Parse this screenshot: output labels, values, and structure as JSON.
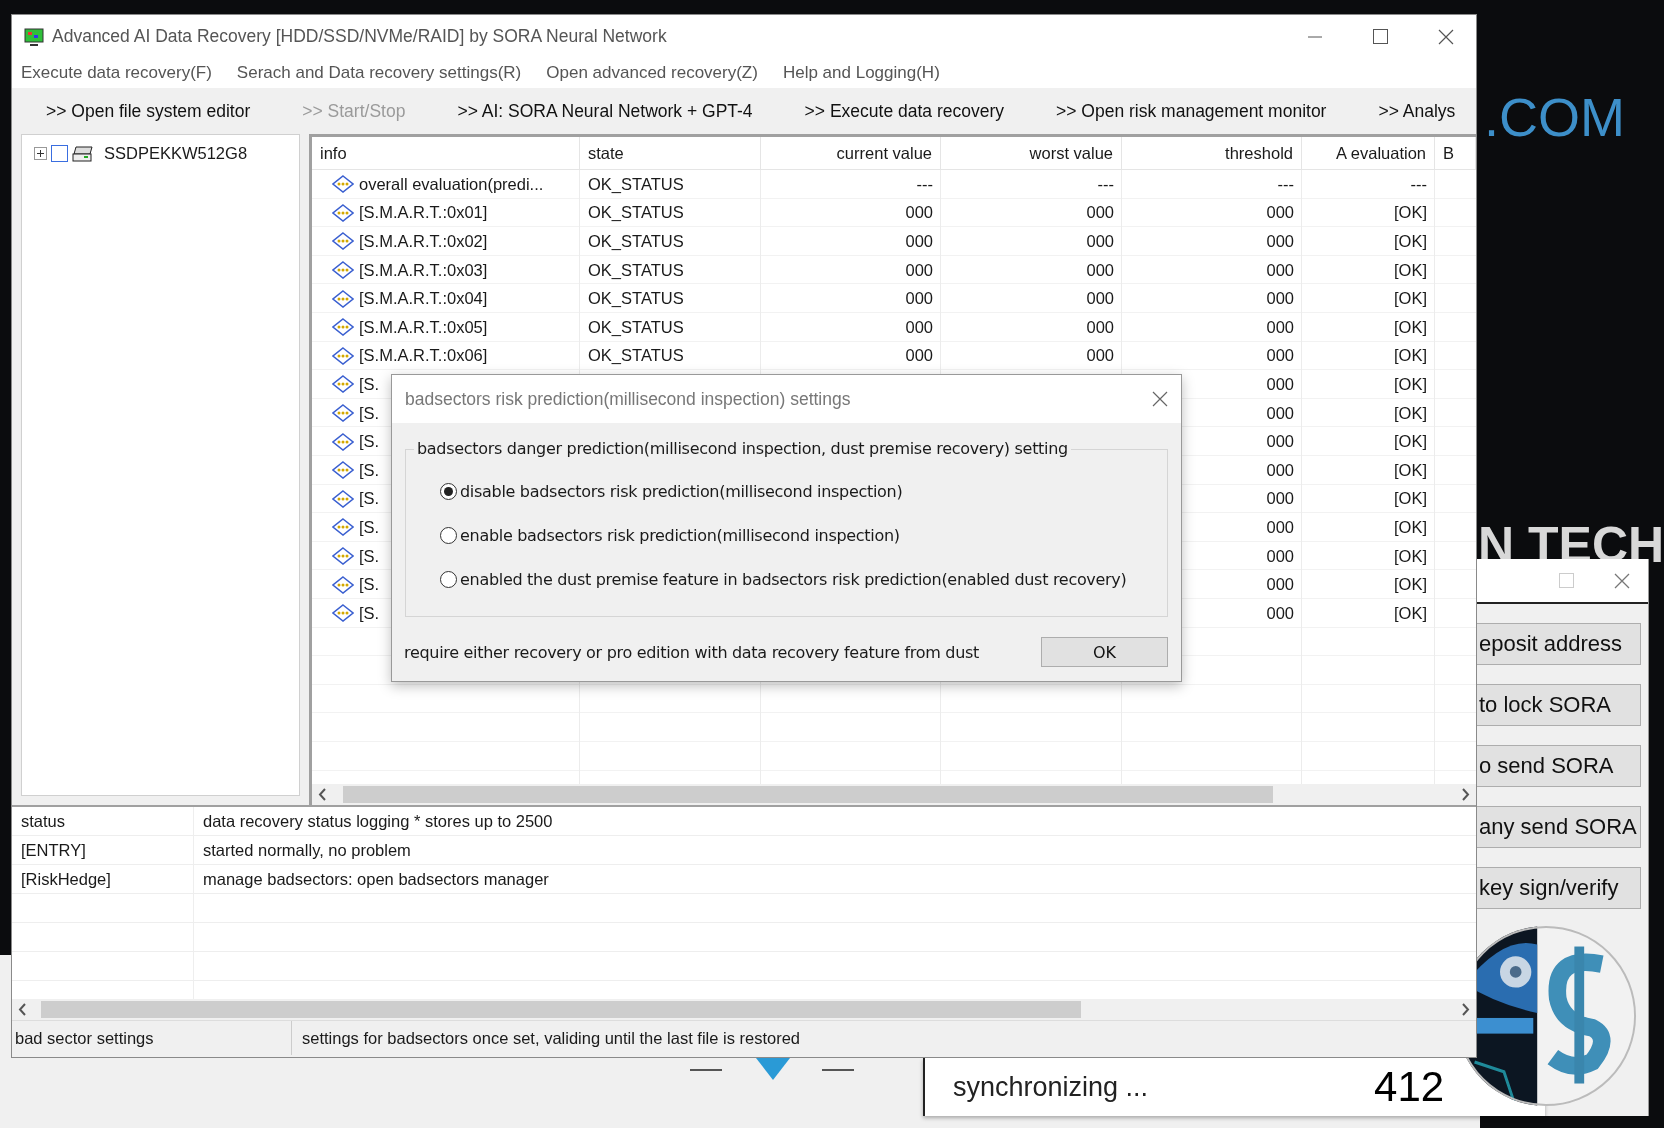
{
  "desktop": {
    "banner_text": ".COM",
    "headline_text": "N TECH"
  },
  "window": {
    "title": "Advanced AI Data Recovery [HDD/SSD/NVMe/RAID] by SORA Neural Network",
    "menu": [
      "Execute data recovery(F)",
      "Serach and Data recovery settings(R)",
      "Open advanced recovery(Z)",
      "Help and Logging(H)"
    ],
    "toolbar": [
      {
        "label": ">> Open file system editor",
        "disabled": false
      },
      {
        "label": ">> Start/Stop",
        "disabled": true
      },
      {
        "label": ">> AI: SORA Neural Network + GPT-4",
        "disabled": false
      },
      {
        "label": ">> Execute data recovery",
        "disabled": false
      },
      {
        "label": ">> Open risk management monitor",
        "disabled": false
      },
      {
        "label": ">> Analys",
        "disabled": false
      }
    ],
    "tree": [
      {
        "label": "SSDPEKKW512G8",
        "expanded": false,
        "checked": false
      }
    ],
    "table": {
      "columns": [
        "info",
        "state",
        "current value",
        "worst value",
        "threshold",
        "A evaluation",
        "B"
      ],
      "rows": [
        {
          "info": "overall evaluation(predi...",
          "state": "OK_STATUS",
          "current_value": "---",
          "worst_value": "---",
          "threshold": "---",
          "a_evaluation": "---"
        },
        {
          "info": "[S.M.A.R.T.:0x01]",
          "state": "OK_STATUS",
          "current_value": "000",
          "worst_value": "000",
          "threshold": "000",
          "a_evaluation": "[OK]"
        },
        {
          "info": "[S.M.A.R.T.:0x02]",
          "state": "OK_STATUS",
          "current_value": "000",
          "worst_value": "000",
          "threshold": "000",
          "a_evaluation": "[OK]"
        },
        {
          "info": "[S.M.A.R.T.:0x03]",
          "state": "OK_STATUS",
          "current_value": "000",
          "worst_value": "000",
          "threshold": "000",
          "a_evaluation": "[OK]"
        },
        {
          "info": "[S.M.A.R.T.:0x04]",
          "state": "OK_STATUS",
          "current_value": "000",
          "worst_value": "000",
          "threshold": "000",
          "a_evaluation": "[OK]"
        },
        {
          "info": "[S.M.A.R.T.:0x05]",
          "state": "OK_STATUS",
          "current_value": "000",
          "worst_value": "000",
          "threshold": "000",
          "a_evaluation": "[OK]"
        },
        {
          "info": "[S.M.A.R.T.:0x06]",
          "state": "OK_STATUS",
          "current_value": "000",
          "worst_value": "000",
          "threshold": "000",
          "a_evaluation": "[OK]"
        },
        {
          "info": "[S.",
          "threshold": "000",
          "a_evaluation": "[OK]"
        },
        {
          "info": "[S.",
          "threshold": "000",
          "a_evaluation": "[OK]"
        },
        {
          "info": "[S.",
          "threshold": "000",
          "a_evaluation": "[OK]"
        },
        {
          "info": "[S.",
          "threshold": "000",
          "a_evaluation": "[OK]"
        },
        {
          "info": "[S.",
          "threshold": "000",
          "a_evaluation": "[OK]"
        },
        {
          "info": "[S.",
          "threshold": "000",
          "a_evaluation": "[OK]"
        },
        {
          "info": "[S.",
          "threshold": "000",
          "a_evaluation": "[OK]"
        },
        {
          "info": "[S.",
          "threshold": "000",
          "a_evaluation": "[OK]"
        },
        {
          "info": "[S.",
          "threshold": "000",
          "a_evaluation": "[OK]"
        }
      ]
    },
    "log": {
      "columns": [
        "status",
        "data recovery status logging * stores up to 2500"
      ],
      "rows": [
        {
          "source": "[ENTRY]",
          "message": "started normally, no problem"
        },
        {
          "source": "[RiskHedge]",
          "message": "manage badsectors: open badsectors manager"
        }
      ]
    },
    "status_bar": [
      "bad sector settings",
      "settings for badsectors once set, validing until the last file is restored"
    ]
  },
  "dialog": {
    "title": "badsectors risk prediction(millisecond inspection) settings",
    "group_label": "badsectors danger prediction(millisecond inspection, dust premise recovery) setting",
    "options": [
      {
        "label": "disable badsectors risk prediction(millisecond inspection)",
        "selected": true
      },
      {
        "label": "enable badsectors risk prediction(millisecond inspection)",
        "selected": false
      },
      {
        "label": "enabled the dust premise feature in badsectors risk prediction(enabled dust recovery)",
        "selected": false
      }
    ],
    "note": "require either recovery or pro edition with data recovery feature from dust",
    "button": "OK"
  },
  "side_window": {
    "buttons": [
      "eposit address",
      "to lock SORA",
      "o send SORA",
      "any send SORA",
      "key sign/verify"
    ]
  },
  "sync_panel": {
    "text": "synchronizing ...",
    "count": "412"
  }
}
